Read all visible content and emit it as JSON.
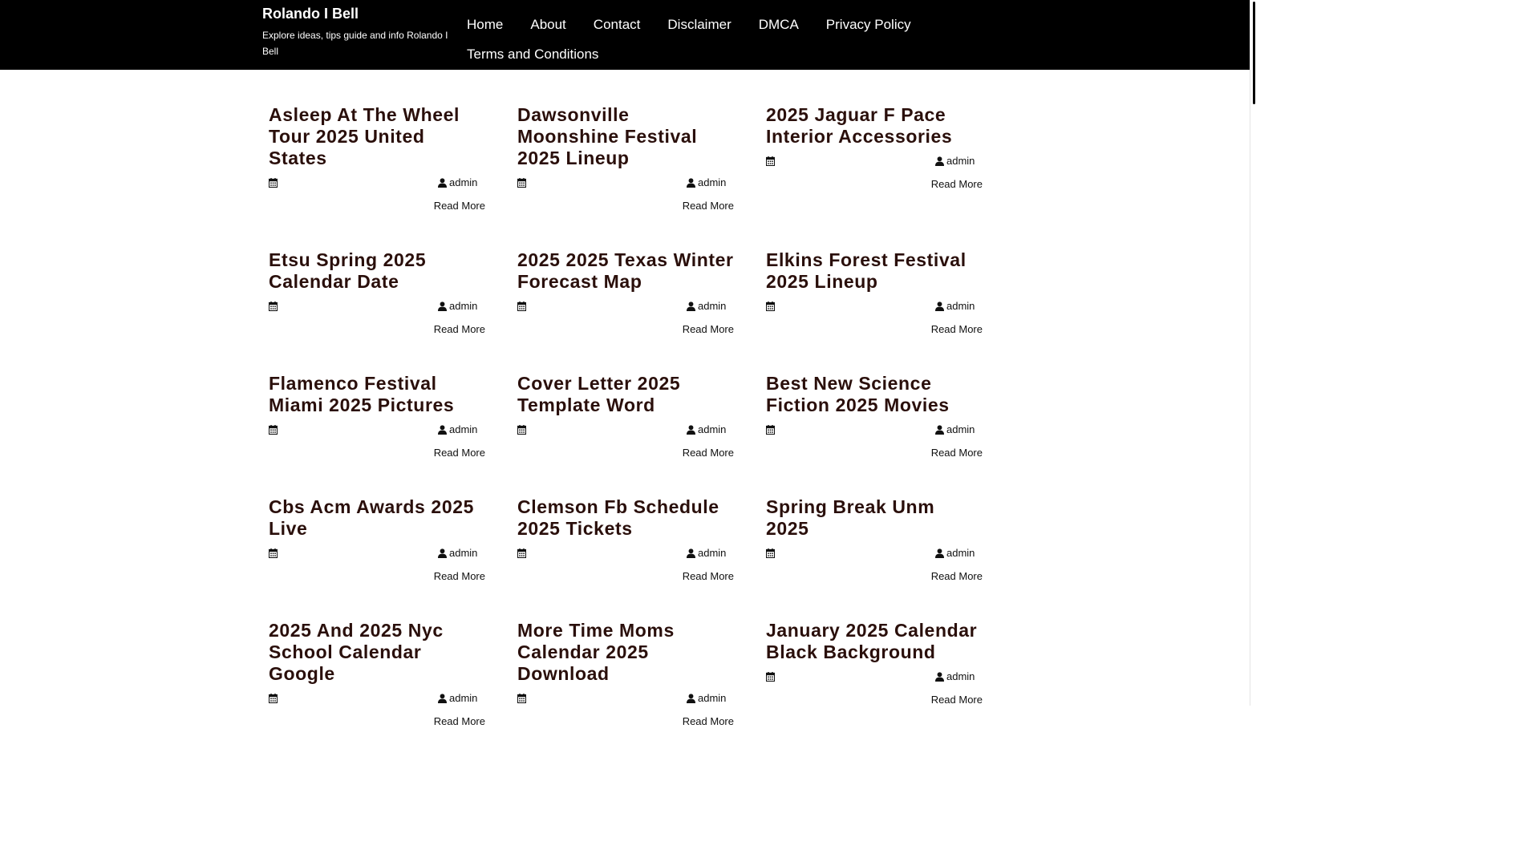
{
  "site": {
    "title": "Rolando I Bell",
    "tagline": "Explore ideas, tips guide and info Rolando I Bell"
  },
  "nav": [
    "Home",
    "About",
    "Contact",
    "Disclaimer",
    "DMCA",
    "Privacy Policy",
    "Terms and Conditions"
  ],
  "icons": {
    "date": "calendar-icon",
    "author": "user-icon"
  },
  "posts": [
    {
      "title": "Asleep At The Wheel Tour 2025 United States",
      "author": "admin",
      "read_more": "Read More"
    },
    {
      "title": "Dawsonville Moonshine Festival 2025 Lineup",
      "author": "admin",
      "read_more": "Read More"
    },
    {
      "title": "2025 Jaguar F Pace Interior Accessories",
      "author": "admin",
      "read_more": "Read More"
    },
    {
      "title": "Etsu Spring 2025 Calendar Date",
      "author": "admin",
      "read_more": "Read More"
    },
    {
      "title": "2025 2025 Texas Winter Forecast Map",
      "author": "admin",
      "read_more": "Read More"
    },
    {
      "title": "Elkins Forest Festival 2025 Lineup",
      "author": "admin",
      "read_more": "Read More"
    },
    {
      "title": "Flamenco Festival Miami 2025 Pictures",
      "author": "admin",
      "read_more": "Read More"
    },
    {
      "title": "Cover Letter 2025 Template Word",
      "author": "admin",
      "read_more": "Read More"
    },
    {
      "title": "Best New Science Fiction 2025 Movies",
      "author": "admin",
      "read_more": "Read More"
    },
    {
      "title": "Cbs Acm Awards 2025 Live",
      "author": "admin",
      "read_more": "Read More"
    },
    {
      "title": "Clemson Fb Schedule 2025 Tickets",
      "author": "admin",
      "read_more": "Read More"
    },
    {
      "title": "Spring Break Unm 2025",
      "author": "admin",
      "read_more": "Read More"
    },
    {
      "title": "2025 And 2025 Nyc School Calendar Google",
      "author": "admin",
      "read_more": "Read More"
    },
    {
      "title": "More Time Moms Calendar 2025 Download",
      "author": "admin",
      "read_more": "Read More"
    },
    {
      "title": "January 2025 Calendar Black Background",
      "author": "admin",
      "read_more": "Read More"
    }
  ]
}
